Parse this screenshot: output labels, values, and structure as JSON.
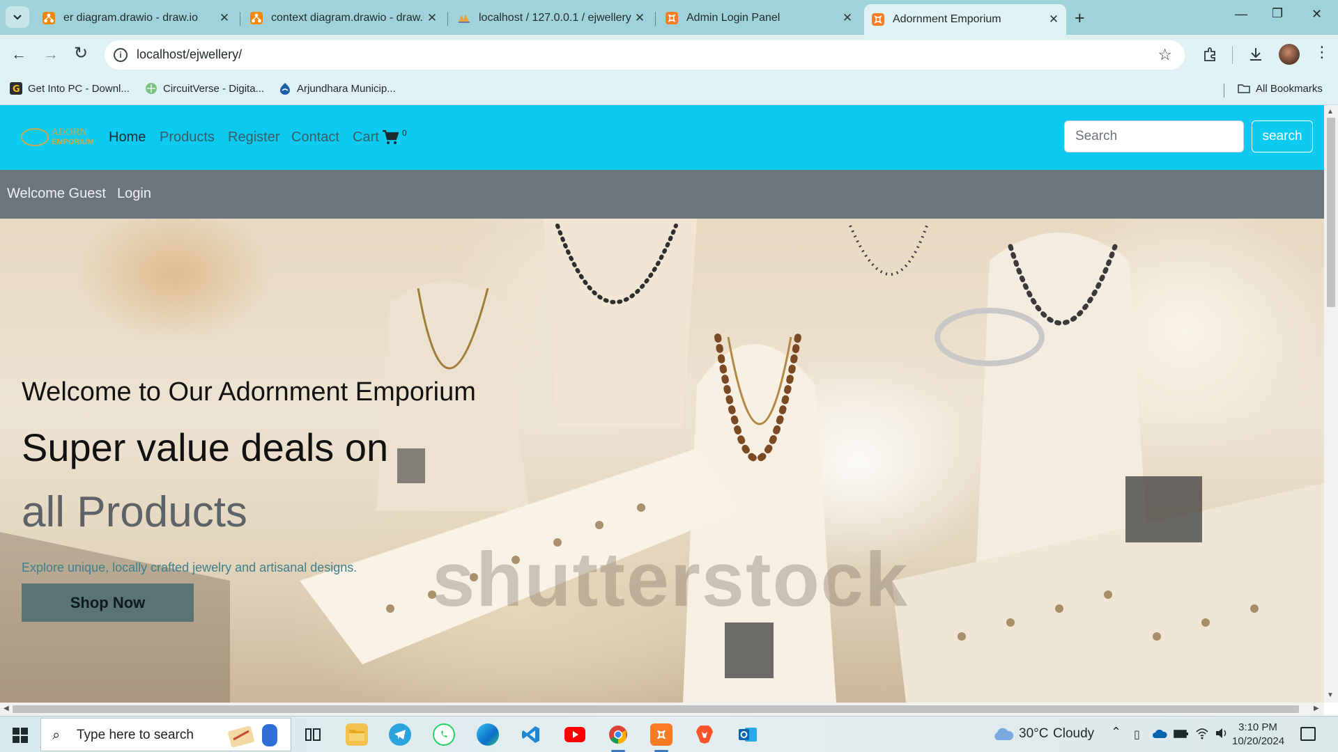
{
  "browser": {
    "tabs": [
      {
        "title": "er diagram.drawio - draw.io",
        "icon": "drawio-icon",
        "active": false
      },
      {
        "title": "context diagram.drawio - draw.io",
        "icon": "drawio-icon",
        "active": false
      },
      {
        "title": "localhost / 127.0.0.1 / ejwellery",
        "icon": "phpmyadmin-icon",
        "active": false
      },
      {
        "title": "Admin Login Panel",
        "icon": "xampp-icon",
        "active": false
      },
      {
        "title": "Adornment Emporium",
        "icon": "xampp-icon",
        "active": true
      }
    ],
    "url": "localhost/ejwellery/",
    "bookmarks": [
      {
        "label": "Get Into PC - Downl...",
        "icon": "getintopc-icon"
      },
      {
        "label": "CircuitVerse - Digita...",
        "icon": "circuitverse-icon"
      },
      {
        "label": "Arjundhara Municip...",
        "icon": "municipality-icon"
      }
    ],
    "all_bookmarks_label": "All Bookmarks"
  },
  "site": {
    "logo": {
      "line1": "ADORN",
      "line2": "EMPORIUM"
    },
    "nav": {
      "home": "Home",
      "products": "Products",
      "register": "Register",
      "contact": "Contact",
      "cart": "Cart",
      "cart_count": "0"
    },
    "search": {
      "placeholder": "Search",
      "button": "search"
    },
    "userbar": {
      "welcome": "Welcome Guest",
      "login": "Login"
    },
    "hero": {
      "welcome": "Welcome to Our Adornment Emporium",
      "headline": "Super value deals on",
      "highlight": "all Products",
      "tagline": "Explore unique, locally crafted jewelry and artisanal designs.",
      "cta": "Shop Now",
      "watermark": "shutterstock"
    },
    "colors": {
      "navbar": "#0dcaf0",
      "userbar": "#6c757d",
      "cta": "#5a7374"
    }
  },
  "taskbar": {
    "search_placeholder": "Type here to search",
    "weather": {
      "temp": "30°C",
      "condition": "Cloudy"
    },
    "time": "3:10 PM",
    "date": "10/20/2024",
    "apps": [
      "task-view-icon",
      "file-explorer-icon",
      "telegram-icon",
      "whatsapp-icon",
      "edge-icon",
      "vscode-icon",
      "youtube-icon",
      "chrome-icon",
      "xampp-icon",
      "brave-icon",
      "outlook-icon"
    ]
  }
}
